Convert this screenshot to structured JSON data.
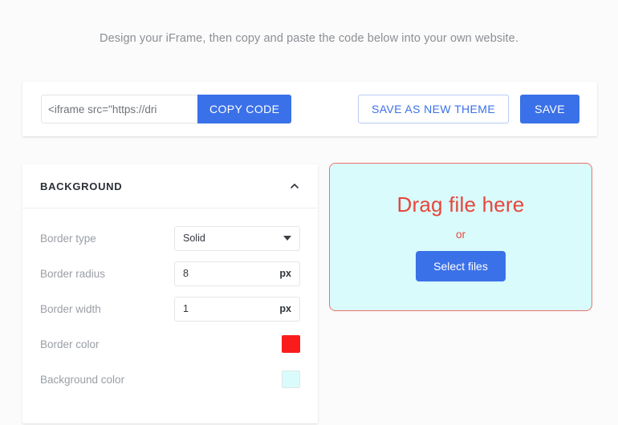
{
  "intro": {
    "text": "Design your iFrame, then copy and paste the code below into your own website."
  },
  "toolbar": {
    "code_value": "<iframe src=\"https://dri",
    "code_placeholder": "<iframe src=\"https://",
    "copy_label": "COPY CODE",
    "save_as_new_theme_label": "SAVE AS NEW THEME",
    "save_label": "SAVE"
  },
  "settings": {
    "section_title": "BACKGROUND",
    "collapse_icon": "chevron-up-icon",
    "rows": [
      {
        "label": "Border type",
        "type": "select",
        "value": "Solid",
        "icon": "chevron-down-icon"
      },
      {
        "label": "Border radius",
        "type": "number",
        "value": "8",
        "unit": "px"
      },
      {
        "label": "Border width",
        "type": "number",
        "value": "1",
        "unit": "px"
      },
      {
        "label": "Border color",
        "type": "color",
        "value": "#fa1c1c"
      },
      {
        "label": "Background color",
        "type": "color",
        "value": "#d9fbfb"
      }
    ]
  },
  "preview": {
    "drag_text": "Drag file here",
    "or_text": "or",
    "select_files_label": "Select files",
    "background_color": "#d9fbfb",
    "border_color": "#e8746c",
    "border_radius": "8px",
    "border_width": "1px"
  },
  "colors": {
    "accent_blue": "#3b71e8",
    "red": "#fa1c1c",
    "pale_cyan": "#d9fbfb",
    "page_background": "#fbfbfb"
  }
}
